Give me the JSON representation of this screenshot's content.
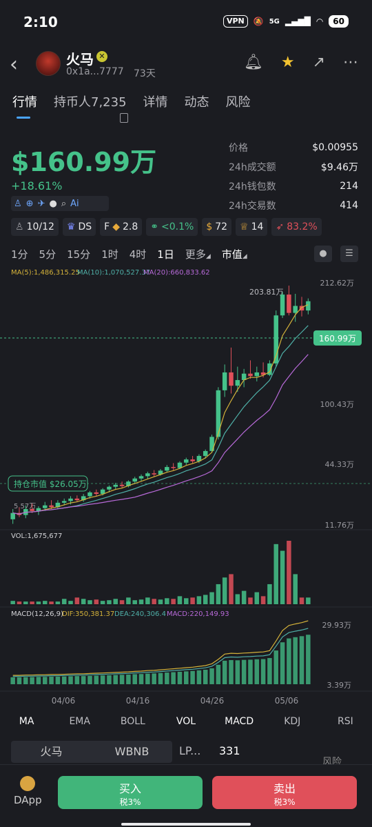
{
  "status_bar": {
    "time": "2:10",
    "vpn": "VPN",
    "network": "5G",
    "battery": "60"
  },
  "token": {
    "name": "火马",
    "address": "0x1a...7777",
    "age": "73天"
  },
  "tabs": [
    "行情",
    "持币人7,235",
    "详情",
    "动态",
    "风险"
  ],
  "price": {
    "market_cap": "$160.99万",
    "change": "+18.61%"
  },
  "stats": [
    {
      "k": "价格",
      "v": "$0.00955"
    },
    {
      "k": "24h成交额",
      "v": "$9.46万"
    },
    {
      "k": "24h钱包数",
      "v": "214"
    },
    {
      "k": "24h交易数",
      "v": "414"
    }
  ],
  "chips": [
    "10/12",
    "DS",
    "2.8",
    "<0.1%",
    "72",
    "14",
    "83.2%"
  ],
  "chip_prefix_f": "F",
  "timeframes": [
    "1分",
    "5分",
    "15分",
    "1时",
    "4时",
    "1日",
    "更多",
    "市值"
  ],
  "ma_legend": {
    "ma5": "MA(5):1,486,315.25",
    "ma10": "MA(10):1,070,527.37",
    "ma20": "MA(20):660,833.62"
  },
  "price_axis": [
    "212.62万",
    "100.43万",
    "44.33万",
    "11.76万"
  ],
  "high_label": "203.81万",
  "low_label": "5.57万",
  "current_label": "160.99万",
  "holding_label": "持仓市值 $26.05万",
  "vol_label": "VOL:1,675,677",
  "macd_legend": {
    "macd": "MACD(12,26,9)",
    "dif": "DIF:350,381.37",
    "dea": "DEA:240,306.4",
    "m": "MACD:220,149.93"
  },
  "macd_axis": [
    "29.93万",
    "3.39万"
  ],
  "dates": [
    "04/06",
    "04/16",
    "04/26",
    "05/06"
  ],
  "indicators": [
    "MA",
    "EMA",
    "BOLL",
    "VOL",
    "MACD",
    "KDJ",
    "RSI"
  ],
  "pair": {
    "base": "火马",
    "quote": "WBNB",
    "lp_label": "LP...",
    "lp_value": "331",
    "risk": "风险"
  },
  "bottom": {
    "dapp": "DApp",
    "buy": "买入",
    "buy_tax": "税3%",
    "sell": "卖出",
    "sell_tax": "税3%"
  },
  "colors": {
    "up": "#45c28a",
    "down": "#e0505a",
    "ma5": "#d4b23a",
    "ma10": "#4fb0a8",
    "ma20": "#b86ad9"
  },
  "chart_data": {
    "type": "candlestick",
    "unit": "万",
    "candles": [
      {
        "o": 6.0,
        "h": 7.0,
        "l": 5.6,
        "c": 6.6
      },
      {
        "o": 6.6,
        "h": 7.2,
        "l": 6.2,
        "c": 6.4
      },
      {
        "o": 6.4,
        "h": 7.4,
        "l": 6.1,
        "c": 7.0
      },
      {
        "o": 7.0,
        "h": 7.6,
        "l": 6.6,
        "c": 6.8
      },
      {
        "o": 6.8,
        "h": 7.3,
        "l": 6.4,
        "c": 7.1
      },
      {
        "o": 7.1,
        "h": 7.8,
        "l": 6.8,
        "c": 7.4
      },
      {
        "o": 7.4,
        "h": 8.0,
        "l": 7.0,
        "c": 7.2
      },
      {
        "o": 7.2,
        "h": 8.0,
        "l": 7.0,
        "c": 7.7
      },
      {
        "o": 7.7,
        "h": 8.2,
        "l": 7.4,
        "c": 7.9
      },
      {
        "o": 7.9,
        "h": 8.5,
        "l": 7.5,
        "c": 8.2
      },
      {
        "o": 8.2,
        "h": 8.6,
        "l": 7.8,
        "c": 8.0
      },
      {
        "o": 8.0,
        "h": 8.8,
        "l": 7.8,
        "c": 8.5
      },
      {
        "o": 8.5,
        "h": 9.2,
        "l": 8.2,
        "c": 9.0
      },
      {
        "o": 9.0,
        "h": 9.4,
        "l": 8.5,
        "c": 8.8
      },
      {
        "o": 8.8,
        "h": 9.6,
        "l": 8.6,
        "c": 9.4
      },
      {
        "o": 9.4,
        "h": 10.0,
        "l": 9.0,
        "c": 9.8
      },
      {
        "o": 9.8,
        "h": 10.4,
        "l": 9.4,
        "c": 10.1
      },
      {
        "o": 10.1,
        "h": 10.6,
        "l": 9.6,
        "c": 9.9
      },
      {
        "o": 9.9,
        "h": 10.8,
        "l": 9.7,
        "c": 10.6
      },
      {
        "o": 10.6,
        "h": 11.4,
        "l": 10.2,
        "c": 11.1
      },
      {
        "o": 11.1,
        "h": 11.8,
        "l": 10.7,
        "c": 11.5
      },
      {
        "o": 11.5,
        "h": 12.3,
        "l": 11.0,
        "c": 12.0
      },
      {
        "o": 12.0,
        "h": 12.6,
        "l": 11.4,
        "c": 11.8
      },
      {
        "o": 11.8,
        "h": 12.8,
        "l": 11.6,
        "c": 12.5
      },
      {
        "o": 12.5,
        "h": 13.6,
        "l": 12.2,
        "c": 13.2
      },
      {
        "o": 13.2,
        "h": 14.0,
        "l": 12.6,
        "c": 13.0
      },
      {
        "o": 13.0,
        "h": 14.4,
        "l": 12.8,
        "c": 14.1
      },
      {
        "o": 14.1,
        "h": 15.2,
        "l": 13.6,
        "c": 14.8
      },
      {
        "o": 14.8,
        "h": 15.6,
        "l": 14.0,
        "c": 14.4
      },
      {
        "o": 14.4,
        "h": 16.0,
        "l": 14.0,
        "c": 15.6
      },
      {
        "o": 15.6,
        "h": 17.2,
        "l": 15.0,
        "c": 16.8
      },
      {
        "o": 16.8,
        "h": 21.5,
        "l": 16.4,
        "c": 20.8
      },
      {
        "o": 20.8,
        "h": 44.0,
        "l": 20.0,
        "c": 42.0
      },
      {
        "o": 42.0,
        "h": 62.0,
        "l": 38.0,
        "c": 55.0
      },
      {
        "o": 55.0,
        "h": 80.0,
        "l": 40.0,
        "c": 45.0
      },
      {
        "o": 45.0,
        "h": 60.0,
        "l": 41.0,
        "c": 49.0
      },
      {
        "o": 49.0,
        "h": 58.0,
        "l": 44.0,
        "c": 54.0
      },
      {
        "o": 54.0,
        "h": 66.0,
        "l": 50.0,
        "c": 52.0
      },
      {
        "o": 52.0,
        "h": 60.0,
        "l": 48.0,
        "c": 55.0
      },
      {
        "o": 55.0,
        "h": 64.0,
        "l": 51.0,
        "c": 53.0
      },
      {
        "o": 53.0,
        "h": 66.0,
        "l": 52.0,
        "c": 63.0
      },
      {
        "o": 63.0,
        "h": 140.0,
        "l": 60.0,
        "c": 130.0
      },
      {
        "o": 130.0,
        "h": 185.0,
        "l": 125.0,
        "c": 178.0
      },
      {
        "o": 178.0,
        "h": 203.81,
        "l": 130.0,
        "c": 135.0
      },
      {
        "o": 135.0,
        "h": 180.0,
        "l": 118.0,
        "c": 150.0
      },
      {
        "o": 150.0,
        "h": 172.0,
        "l": 128.0,
        "c": 140.0
      },
      {
        "o": 140.0,
        "h": 168.0,
        "l": 132.0,
        "c": 160.99
      }
    ],
    "volume": [
      0.05,
      0.04,
      0.04,
      0.04,
      0.04,
      0.05,
      0.04,
      0.04,
      0.08,
      0.05,
      0.1,
      0.08,
      0.06,
      0.07,
      0.05,
      0.06,
      0.08,
      0.06,
      0.1,
      0.06,
      0.07,
      0.1,
      0.08,
      0.07,
      0.09,
      0.08,
      0.12,
      0.09,
      0.1,
      0.12,
      0.14,
      0.18,
      0.3,
      0.4,
      0.45,
      0.15,
      0.2,
      0.1,
      0.18,
      0.12,
      0.3,
      0.9,
      0.8,
      0.95,
      0.45,
      0.1,
      0.1
    ],
    "macd_hist": [
      3.4,
      3.4,
      3.5,
      3.5,
      3.6,
      3.6,
      3.7,
      3.7,
      3.8,
      3.9,
      4.0,
      4.0,
      4.1,
      4.2,
      4.3,
      4.4,
      4.5,
      4.6,
      4.7,
      4.9,
      5.0,
      5.2,
      5.3,
      5.5,
      5.7,
      5.9,
      6.1,
      6.3,
      6.5,
      6.8,
      7.1,
      7.8,
      9.5,
      11.5,
      11.8,
      11.7,
      11.9,
      12.0,
      12.2,
      12.3,
      12.8,
      16.5,
      20.5,
      22.4,
      23.0,
      23.5,
      24.2
    ],
    "ylim_log": [
      5.57,
      212.62
    ]
  }
}
